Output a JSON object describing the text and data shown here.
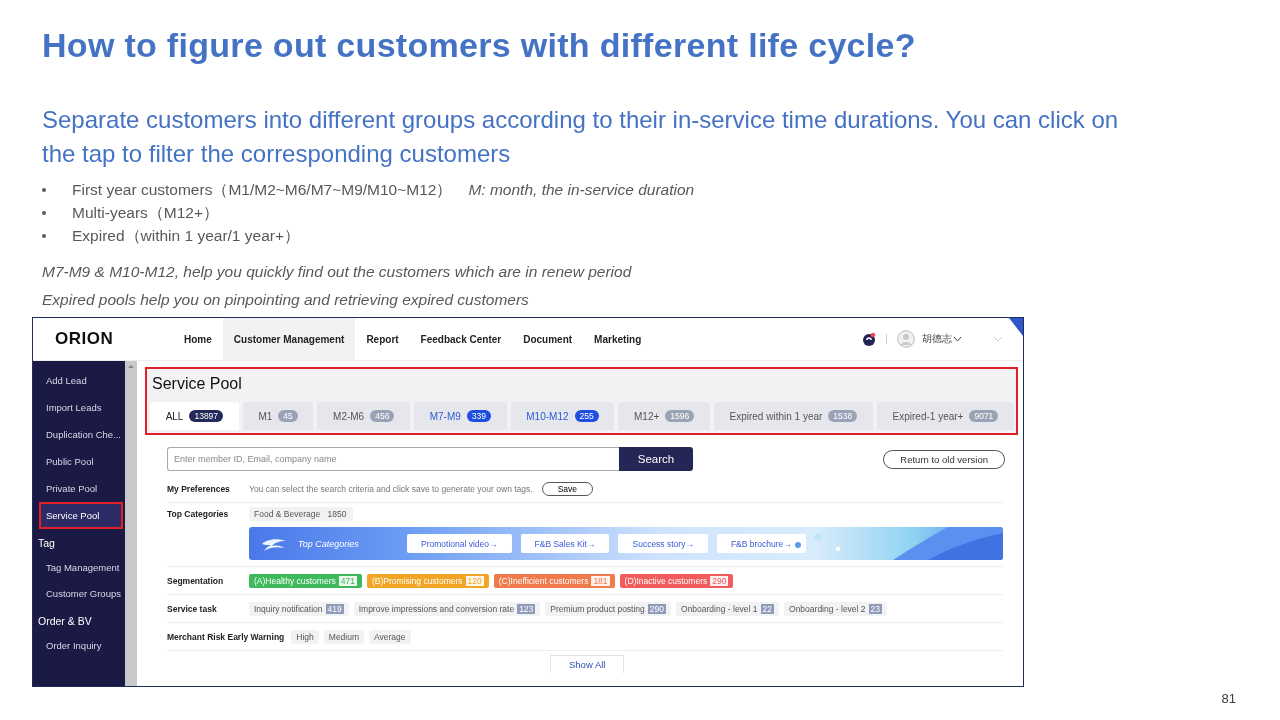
{
  "slide": {
    "title": "How to figure out customers with different life cycle?",
    "subtitle": "Separate customers into different groups according to their in-service time durations. You can click on the tap to filter the corresponding customers",
    "bullets": [
      {
        "text": "First year customers（M1/M2~M6/M7~M9/M10~M12）",
        "note": "M: month, the in-service duration"
      },
      {
        "text": "Multi-years（M12+）"
      },
      {
        "text": "Expired（within 1 year/1 year+）"
      }
    ],
    "notes": [
      "M7-M9 & M10-M12,  help you quickly find out the customers which are in renew period",
      "Expired pools help you on pinpointing and retrieving expired customers"
    ],
    "page_number": "81"
  },
  "app": {
    "logo": "ORION",
    "nav": [
      {
        "label": "Home",
        "selected": false
      },
      {
        "label": "Customer Management",
        "selected": true
      },
      {
        "label": "Report",
        "selected": false
      },
      {
        "label": "Feedback Center",
        "selected": false
      },
      {
        "label": "Document",
        "selected": false
      },
      {
        "label": "Marketing",
        "selected": false
      }
    ],
    "user": {
      "name": "胡德志"
    },
    "sidebar": [
      {
        "items": [
          {
            "label": "Add Lead",
            "selected": false
          },
          {
            "label": "Import Leads",
            "selected": false
          },
          {
            "label": "Duplication Che...",
            "selected": false
          },
          {
            "label": "Public Pool",
            "selected": false
          },
          {
            "label": "Private Pool",
            "selected": false
          },
          {
            "label": "Service Pool",
            "selected": true
          }
        ]
      },
      {
        "title": "Tag",
        "items": [
          {
            "label": "Tag Management",
            "selected": false
          },
          {
            "label": "Customer Groups",
            "selected": false
          }
        ]
      },
      {
        "title": "Order & BV",
        "items": [
          {
            "label": "Order Inquiry",
            "selected": false
          }
        ]
      }
    ],
    "page_title": "Service Pool",
    "tabs": [
      {
        "label": "ALL",
        "count": "13897",
        "selected": true,
        "highlighted": false
      },
      {
        "label": "M1",
        "count": "45",
        "selected": false,
        "highlighted": false
      },
      {
        "label": "M2-M6",
        "count": "456",
        "selected": false,
        "highlighted": false
      },
      {
        "label": "M7-M9",
        "count": "339",
        "selected": false,
        "highlighted": true
      },
      {
        "label": "M10-M12",
        "count": "255",
        "selected": false,
        "highlighted": true
      },
      {
        "label": "M12+",
        "count": "1596",
        "selected": false,
        "highlighted": false
      },
      {
        "label": "Expired within 1 year",
        "count": "1538",
        "selected": false,
        "highlighted": false
      },
      {
        "label": "Expired-1 year+",
        "count": "9071",
        "selected": false,
        "highlighted": false
      }
    ],
    "search": {
      "placeholder": "Enter member ID, Email, company name",
      "button": "Search"
    },
    "return_button": "Return to old version",
    "preferences": {
      "label": "My Preferences",
      "hint": "You can select the search criteria and click save to generate your own tags.",
      "button": "Save"
    },
    "top_categories": {
      "label": "Top Categories",
      "tag": {
        "label": "Food & Beverage",
        "count": "1850"
      },
      "banner": {
        "title": "Top Categories",
        "links": [
          "Promotional video→",
          "F&B Sales Kit→",
          "Success story→",
          "F&B brochure→"
        ]
      }
    },
    "segmentation": {
      "label": "Segmentation",
      "tags": [
        {
          "label": "(A)Healthy customers",
          "count": "471",
          "color": "#3db85a"
        },
        {
          "label": "(B)Promising customers",
          "count": "120",
          "color": "#f2a524"
        },
        {
          "label": "(C)Inefficient customers",
          "count": "181",
          "color": "#f07a4a"
        },
        {
          "label": "(D)Inactive customers",
          "count": "290",
          "color": "#f25c5c"
        }
      ]
    },
    "service_task": {
      "label": "Service task",
      "tags": [
        {
          "label": "Inquiry notification",
          "count": "419"
        },
        {
          "label": "Improve impressions and conversion rate",
          "count": "123"
        },
        {
          "label": "Premium product posting",
          "count": "290"
        },
        {
          "label": "Onboarding - level 1",
          "count": "22"
        },
        {
          "label": "Onboarding - level 2",
          "count": "23"
        }
      ]
    },
    "risk": {
      "label": "Merchant Risk Early Warning",
      "options": [
        "High",
        "Medium",
        "Average"
      ]
    },
    "show_all": "Show All"
  }
}
